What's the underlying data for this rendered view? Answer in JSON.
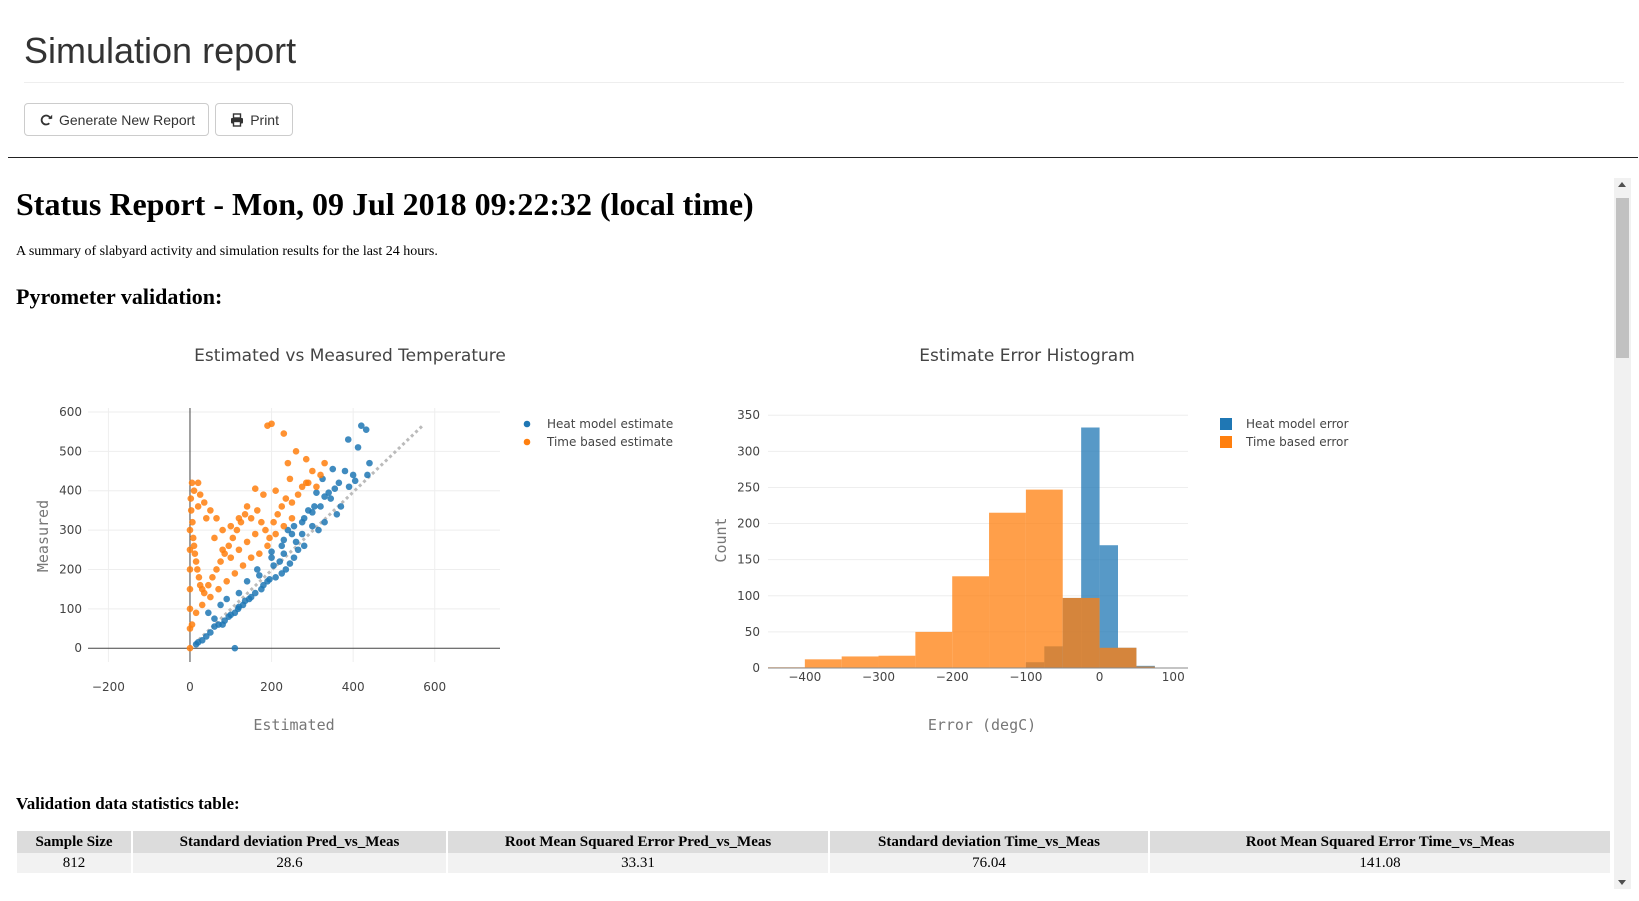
{
  "app": {
    "title": "Simulation report",
    "buttons": {
      "generate_label": "Generate New Report",
      "print_label": "Print"
    }
  },
  "report": {
    "title": "Status Report - Mon, 09 Jul 2018 09:22:32 (local time)",
    "summary": "A summary of slabyard activity and simulation results for the last 24 hours.",
    "section_heading": "Pyrometer validation:",
    "table_heading": "Validation data statistics table:"
  },
  "colors": {
    "heat": "#1f77b4",
    "time": "#ff7f0e",
    "diagonal": "#bbbbbb"
  },
  "icons": {
    "generate": "refresh-icon",
    "print": "print-icon"
  },
  "chart_data": [
    {
      "type": "scatter",
      "title": "Estimated vs Measured Temperature",
      "xlabel": "Estimated",
      "ylabel": "Measured",
      "xlim": [
        -250,
        760
      ],
      "ylim": [
        -35,
        610
      ],
      "x_ticks": [
        -200,
        0,
        200,
        400,
        600
      ],
      "y_ticks": [
        0,
        100,
        200,
        300,
        400,
        500,
        600
      ],
      "grid": true,
      "legend_position": "top-right",
      "diagonal": [
        [
          0,
          0
        ],
        [
          570,
          565
        ]
      ],
      "series": [
        {
          "name": "Heat model estimate",
          "color": "#1f77b4",
          "points": [
            [
              420,
              565
            ],
            [
              432,
              555
            ],
            [
              388,
              530
            ],
            [
              412,
              510
            ],
            [
              440,
              470
            ],
            [
              380,
              450
            ],
            [
              435,
              440
            ],
            [
              405,
              425
            ],
            [
              390,
              410
            ],
            [
              350,
              455
            ],
            [
              325,
              430
            ],
            [
              345,
              380
            ],
            [
              310,
              395
            ],
            [
              290,
              350
            ],
            [
              300,
              310
            ],
            [
              275,
              290
            ],
            [
              260,
              270
            ],
            [
              240,
              300
            ],
            [
              230,
              240
            ],
            [
              220,
              220
            ],
            [
              205,
              210
            ],
            [
              195,
              175
            ],
            [
              180,
              160
            ],
            [
              170,
              185
            ],
            [
              150,
              130
            ],
            [
              135,
              120
            ],
            [
              120,
              105
            ],
            [
              110,
              90
            ],
            [
              95,
              80
            ],
            [
              80,
              60
            ],
            [
              60,
              55
            ],
            [
              50,
              40
            ],
            [
              40,
              30
            ],
            [
              30,
              20
            ],
            [
              20,
              15
            ],
            [
              15,
              10
            ],
            [
              360,
              340
            ],
            [
              370,
              360
            ],
            [
              330,
              320
            ],
            [
              315,
              300
            ],
            [
              280,
              260
            ],
            [
              265,
              250
            ],
            [
              255,
              230
            ],
            [
              245,
              215
            ],
            [
              235,
              200
            ],
            [
              225,
              190
            ],
            [
              210,
              180
            ],
            [
              190,
              170
            ],
            [
              175,
              150
            ],
            [
              160,
              140
            ],
            [
              145,
              125
            ],
            [
              130,
              110
            ],
            [
              118,
              100
            ],
            [
              100,
              85
            ],
            [
              85,
              70
            ],
            [
              70,
              60
            ],
            [
              120,
              140
            ],
            [
              140,
              170
            ],
            [
              165,
              200
            ],
            [
              200,
              245
            ],
            [
              230,
              275
            ],
            [
              255,
              310
            ],
            [
              280,
              330
            ],
            [
              305,
              360
            ],
            [
              330,
              385
            ],
            [
              355,
              405
            ],
            [
              400,
              440
            ],
            [
              110,
              0
            ],
            [
              60,
              75
            ],
            [
              45,
              90
            ],
            [
              75,
              110
            ],
            [
              90,
              125
            ],
            [
              320,
              360
            ],
            [
              340,
              395
            ],
            [
              365,
              420
            ],
            [
              300,
              345
            ],
            [
              275,
              320
            ],
            [
              250,
              290
            ],
            [
              225,
              260
            ],
            [
              200,
              230
            ]
          ]
        },
        {
          "name": "Time based estimate",
          "color": "#ff7f0e",
          "points": [
            [
              190,
              565
            ],
            [
              200,
              570
            ],
            [
              230,
              545
            ],
            [
              240,
              470
            ],
            [
              260,
              500
            ],
            [
              285,
              480
            ],
            [
              300,
              450
            ],
            [
              330,
              470
            ],
            [
              285,
              420
            ],
            [
              245,
              430
            ],
            [
              210,
              400
            ],
            [
              180,
              390
            ],
            [
              160,
              405
            ],
            [
              140,
              360
            ],
            [
              120,
              330
            ],
            [
              100,
              310
            ],
            [
              80,
              300
            ],
            [
              60,
              280
            ],
            [
              40,
              330
            ],
            [
              20,
              360
            ],
            [
              10,
              400
            ],
            [
              5,
              420
            ],
            [
              2,
              380
            ],
            [
              0,
              300
            ],
            [
              0,
              250
            ],
            [
              0,
              200
            ],
            [
              0,
              150
            ],
            [
              0,
              100
            ],
            [
              0,
              50
            ],
            [
              0,
              0
            ],
            [
              3,
              350
            ],
            [
              6,
              320
            ],
            [
              8,
              280
            ],
            [
              10,
              260
            ],
            [
              12,
              240
            ],
            [
              15,
              220
            ],
            [
              18,
              200
            ],
            [
              22,
              180
            ],
            [
              25,
              160
            ],
            [
              30,
              150
            ],
            [
              35,
              140
            ],
            [
              45,
              160
            ],
            [
              55,
              180
            ],
            [
              65,
              200
            ],
            [
              75,
              220
            ],
            [
              85,
              240
            ],
            [
              95,
              260
            ],
            [
              105,
              280
            ],
            [
              115,
              300
            ],
            [
              125,
              320
            ],
            [
              135,
              340
            ],
            [
              150,
              330
            ],
            [
              165,
              350
            ],
            [
              175,
              320
            ],
            [
              185,
              300
            ],
            [
              195,
              280
            ],
            [
              205,
              320
            ],
            [
              215,
              340
            ],
            [
              225,
              360
            ],
            [
              235,
              380
            ],
            [
              250,
              370
            ],
            [
              265,
              390
            ],
            [
              275,
              410
            ],
            [
              290,
              420
            ],
            [
              310,
              410
            ],
            [
              320,
              440
            ],
            [
              250,
              330
            ],
            [
              230,
              310
            ],
            [
              210,
              290
            ],
            [
              190,
              260
            ],
            [
              170,
              240
            ],
            [
              150,
              230
            ],
            [
              130,
              210
            ],
            [
              110,
              190
            ],
            [
              90,
              170
            ],
            [
              70,
              150
            ],
            [
              50,
              130
            ],
            [
              30,
              110
            ],
            [
              15,
              90
            ],
            [
              5,
              60
            ],
            [
              20,
              420
            ],
            [
              25,
              390
            ],
            [
              35,
              370
            ],
            [
              50,
              350
            ],
            [
              65,
              330
            ],
            [
              80,
              250
            ],
            [
              100,
              230
            ],
            [
              120,
              250
            ],
            [
              140,
              270
            ],
            [
              160,
              290
            ]
          ]
        }
      ]
    },
    {
      "type": "bar",
      "title": "Estimate Error Histogram",
      "xlabel": "Error (degC)",
      "ylabel": "Count",
      "xlim": [
        -450,
        120
      ],
      "ylim": [
        0,
        360
      ],
      "x_ticks": [
        -400,
        -300,
        -200,
        -100,
        0,
        100
      ],
      "y_ticks": [
        0,
        50,
        100,
        150,
        200,
        250,
        300,
        350
      ],
      "grid": true,
      "legend_position": "top-right",
      "overlay": true,
      "series": [
        {
          "name": "Heat model error",
          "color": "#1f77b4",
          "bins": [
            [
              -100,
              -75,
              8
            ],
            [
              -75,
              -50,
              30
            ],
            [
              -50,
              -25,
              97
            ],
            [
              -25,
              0,
              333
            ],
            [
              0,
              25,
              170
            ],
            [
              25,
              50,
              28
            ],
            [
              50,
              75,
              3
            ]
          ]
        },
        {
          "name": "Time based error",
          "color": "#ff7f0e",
          "bins": [
            [
              -450,
              -400,
              1
            ],
            [
              -400,
              -350,
              12
            ],
            [
              -350,
              -300,
              16
            ],
            [
              -300,
              -250,
              17
            ],
            [
              -250,
              -200,
              50
            ],
            [
              -200,
              -150,
              127
            ],
            [
              -150,
              -100,
              215
            ],
            [
              -100,
              -50,
              247
            ],
            [
              -50,
              0,
              97
            ],
            [
              0,
              25,
              28
            ],
            [
              25,
              50,
              28
            ],
            [
              50,
              75,
              2
            ]
          ]
        }
      ]
    }
  ],
  "stats_table": {
    "headers": [
      "Sample Size",
      "Standard deviation Pred_vs_Meas",
      "Root Mean Squared Error Pred_vs_Meas",
      "Standard deviation Time_vs_Meas",
      "Root Mean Squared Error Time_vs_Meas"
    ],
    "rows": [
      [
        "812",
        "28.6",
        "33.31",
        "76.04",
        "141.08"
      ]
    ]
  }
}
